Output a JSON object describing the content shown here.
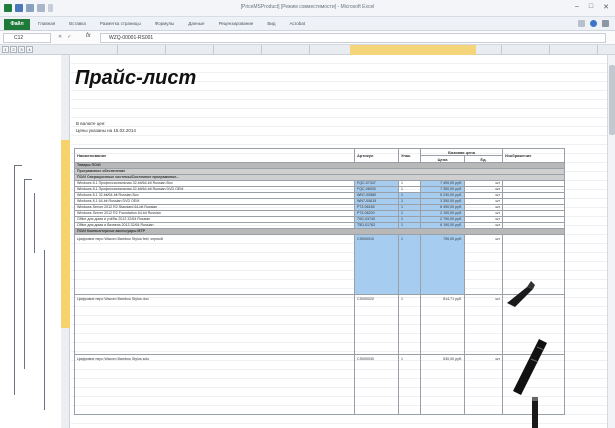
{
  "window": {
    "title": "[PriceMSProduct] [Режим совместимости] - Microsoft Excel",
    "controls": [
      "–",
      "□",
      "✕"
    ]
  },
  "ribbon": {
    "file_tab": "Файл",
    "tabs": [
      "Главная",
      "Вставка",
      "Разметка страницы",
      "Формулы",
      "Данные",
      "Рецензирование",
      "Вид",
      "Acrobat"
    ]
  },
  "formula_bar": {
    "name_box": "C12",
    "fx": "fx",
    "value": "WZQ-00001-RS001"
  },
  "outline_levels": [
    "1",
    "2",
    "3",
    "4"
  ],
  "sheet": {
    "title": "Прайс-лист",
    "meta_line1": "В валюте цен:",
    "meta_line2": "Цены указаны на 15.02.2014"
  },
  "table": {
    "headers": {
      "name": "Наименование",
      "article": "Артикул",
      "unit": "Упак.",
      "price_group": "Базовая цена",
      "price": "Цена",
      "currency": "Ед.",
      "image": "Изображение"
    },
    "category1": "Товары ПО/И",
    "category2": "Программное обеспечение",
    "category3": "ПО/И Операционные системы/Системное программное...",
    "rows": [
      {
        "name": "Windows 8.1 Профессиональная 32-bit/64-bit Russian Box",
        "article": "FQC-07347",
        "unit": "1",
        "price": "7 490,00 руб.",
        "cur": "шт"
      },
      {
        "name": "Windows 8.1 Профессиональная 32-bit/64-bit Russian DVD OEM",
        "article": "FQC-06930",
        "unit": "1",
        "price": "7 350,00 руб.",
        "cur": "шт"
      },
      {
        "name": "Windows 8.1 32-bit/64-bit Russian Box",
        "article": "WN7-00580",
        "unit": "1",
        "price": "5 230,00 руб.",
        "cur": "шт"
      },
      {
        "name": "Windows 8.1 64-bit Russian DVD OEM",
        "article": "WN7-00615",
        "unit": "1",
        "price": "3 350,00 руб.",
        "cur": "шт"
      },
      {
        "name": "Windows Server 2012 R2 Standard 64-bit Russian",
        "article": "P73-06165",
        "unit": "1",
        "price": "6 490,00 руб.",
        "cur": "шт"
      },
      {
        "name": "Windows Server 2012 R2 Foundation 64-bit Russian",
        "article": "P73-06220",
        "unit": "1",
        "price": "2 190,00 руб.",
        "cur": "шт"
      },
      {
        "name": "Office для дома и учёбы 2013 32/64 Russian",
        "article": "79G-03740",
        "unit": "1",
        "price": "2 790,00 руб.",
        "cur": "шт"
      },
      {
        "name": "Office для дома и бизнеса 2013 32/64 Russian",
        "article": "T5D-01763",
        "unit": "1",
        "price": "6 190,00 руб.",
        "cur": "шт"
      }
    ],
    "category4": "ПО/И Компьютерные аксессуары MTP",
    "products": [
      {
        "name": "Цифровое перо Wacom Bamboo Stylus feel, черный",
        "article": "CS000010",
        "unit": "1",
        "price": "790,00 руб.",
        "cur": "шт"
      },
      {
        "name": "Цифровое перо Wacom Bamboo Stylus duo",
        "article": "CS000020",
        "unit": "1",
        "price": "814,71 руб.",
        "cur": "шт"
      },
      {
        "name": "Цифровое перо Wacom Bamboo Stylus solo",
        "article": "CS000030",
        "unit": "1",
        "price": "530,00 руб.",
        "cur": "шт"
      }
    ]
  },
  "colors": {
    "selection_blue": "#a6cdf0",
    "selection_header": "#f5d57a",
    "category_gray": "#b8b8b8",
    "excel_green": "#1f7a3a"
  }
}
